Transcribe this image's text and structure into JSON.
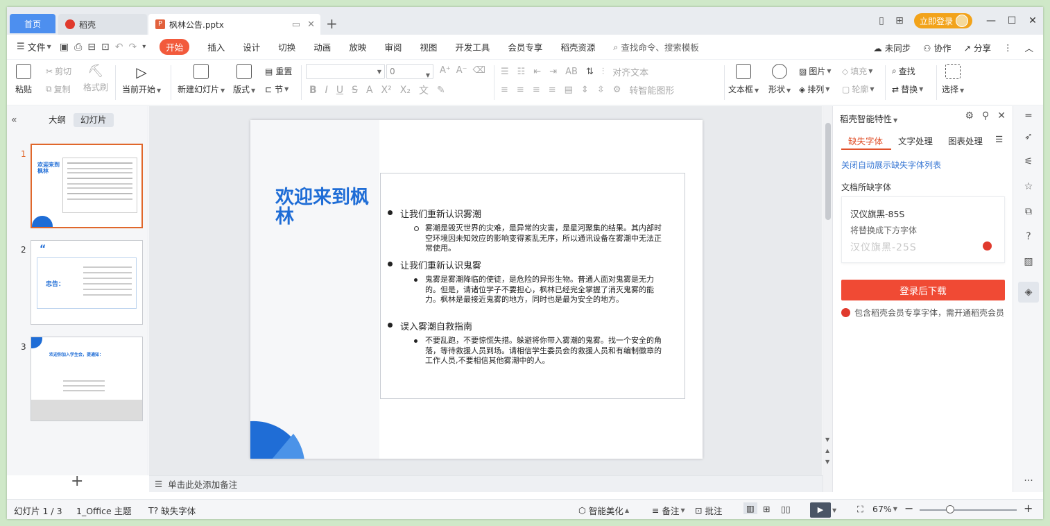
{
  "tabs": {
    "home": "首页",
    "daoke": "稻壳",
    "document": "枫林公告.pptx"
  },
  "titlebar": {
    "login": "立即登录"
  },
  "menu": {
    "file": "文件",
    "items": [
      "开始",
      "插入",
      "设计",
      "切换",
      "动画",
      "放映",
      "审阅",
      "视图",
      "开发工具",
      "会员专享",
      "稻壳资源"
    ],
    "search": "查找命令、搜索模板",
    "sync": "未同步",
    "collab": "协作",
    "share": "分享"
  },
  "ribbon": {
    "paste": "粘贴",
    "cut": "剪切",
    "copy": "复制",
    "format_painter": "格式刷",
    "from_current": "当前开始",
    "new_slide": "新建幻灯片",
    "layout": "版式",
    "section": "节",
    "reset": "重置",
    "font_size": "0",
    "align_text": "对齐文本",
    "smart_art": "转智能图形",
    "textbox": "文本框",
    "shape": "形状",
    "arrange": "排列",
    "picture": "图片",
    "fill": "填充",
    "outline": "轮廓",
    "find": "查找",
    "replace": "替换",
    "select": "选择"
  },
  "left_panel": {
    "tab_outline": "大纲",
    "tab_slides": "幻灯片",
    "thumbs": [
      {
        "num": "1",
        "title": "欢迎来到枫林"
      },
      {
        "num": "2",
        "title": "忠告："
      },
      {
        "num": "3",
        "title": "欢迎你加入学生会，提通知："
      }
    ]
  },
  "slide": {
    "title": "欢迎来到枫林",
    "sections": [
      {
        "heading": "让我们重新认识雾潮",
        "body": "雾潮是毁灭世界的灾难，是异常的灾害，是星河聚集的结果。其内部时空环境因未知效应的影响变得紊乱无序，所以通讯设备在雾潮中无法正常使用。"
      },
      {
        "heading": "让我们重新认识鬼雾",
        "body": "鬼雾是雾潮降临的使徒，是危险的异形生物。普通人面对鬼雾是无力的。但是，请诸位学子不要担心，枫林已经完全掌握了消灭鬼雾的能力。枫林是最接近鬼雾的地方，同时也是最为安全的地方。"
      },
      {
        "heading": "误入雾潮自救指南",
        "body": "不要乱跑，不要惊慌失措。躲避将你带入雾潮的鬼雾。找一个安全的角落，等待救援人员到场。请相信学生委员会的救援人员和有编制徽章的工作人员,不要相信其他雾潮中的人。"
      }
    ]
  },
  "notes_placeholder": "单击此处添加备注",
  "right_pane": {
    "title": "稻壳智能特性",
    "tabs": [
      "缺失字体",
      "文字处理",
      "图表处理"
    ],
    "link": "关闭自动展示缺失字体列表",
    "subtitle": "文档所缺字体",
    "font_name": "汉仪旗黑-85S",
    "replace_hint": "将替换成下方字体",
    "font_sample": "汉仪旗黑-25S",
    "download": "登录后下载",
    "note": "包含稻壳会员专享字体，需开通稻壳会员"
  },
  "statusbar": {
    "slide_count": "幻灯片 1 / 3",
    "theme": "1_Office 主题",
    "missing_font": "缺失字体",
    "smart_beautify": "智能美化",
    "notes": "备注",
    "comments": "批注",
    "zoom": "67%"
  },
  "colors": {
    "accent": "#f25a3c",
    "title_blue": "#1f6dd6",
    "home_tab": "#4d8fef"
  }
}
